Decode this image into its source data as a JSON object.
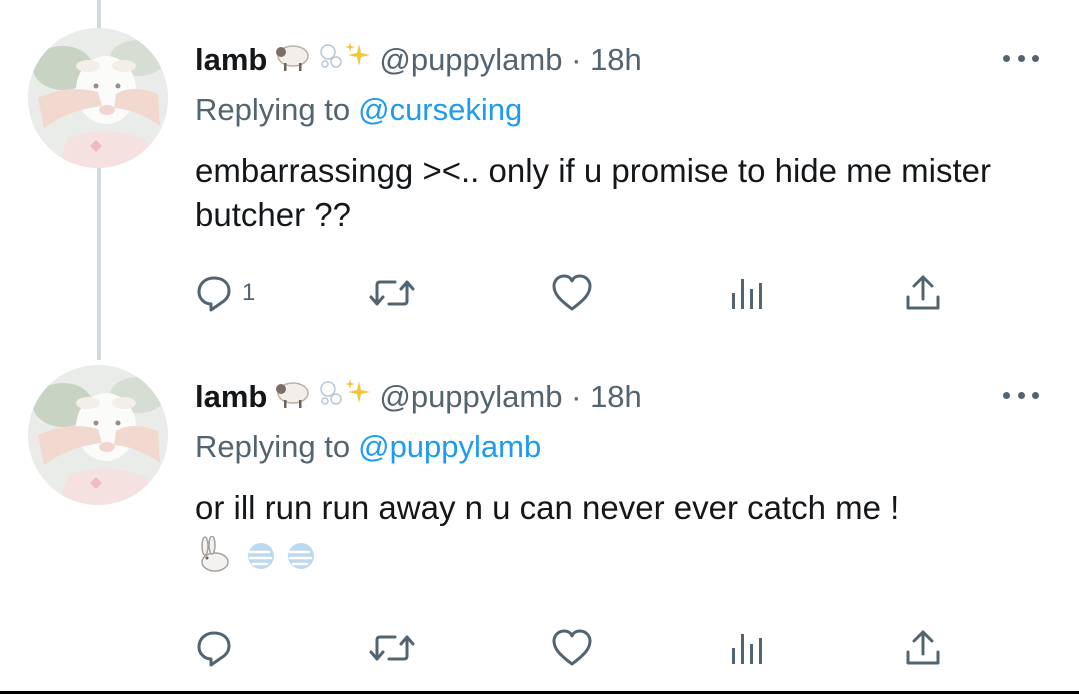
{
  "tweets": [
    {
      "display_name": "lamb",
      "name_emojis": [
        "sheep-emoji",
        "bubbles-emoji",
        "sparkles-emoji"
      ],
      "handle": "@puppylamb",
      "separator": "·",
      "time": "18h",
      "replying_prefix": "Replying to",
      "replying_to": "@curseking",
      "text": "embarrassingg ><.. only if u promise to hide me mister butcher ??",
      "text_emojis": [],
      "reply_count": "1",
      "retweet_count": "",
      "like_count": ""
    },
    {
      "display_name": "lamb",
      "name_emojis": [
        "sheep-emoji",
        "bubbles-emoji",
        "sparkles-emoji"
      ],
      "handle": "@puppylamb",
      "separator": "·",
      "time": "18h",
      "replying_prefix": "Replying to",
      "replying_to": "@puppylamb",
      "text": "or ill run run away n u can never ever catch me !",
      "text_emojis": [
        "rabbit-emoji",
        "dash-emoji",
        "dash-emoji"
      ],
      "reply_count": "",
      "retweet_count": "",
      "like_count": ""
    }
  ],
  "colors": {
    "text_primary": "#14171a",
    "text_secondary": "#536471",
    "link_blue": "#1d9bf0",
    "thread_line": "#cfd9de"
  },
  "icons": [
    "reply-icon",
    "retweet-icon",
    "like-icon",
    "analytics-icon",
    "share-icon",
    "more-icon"
  ]
}
